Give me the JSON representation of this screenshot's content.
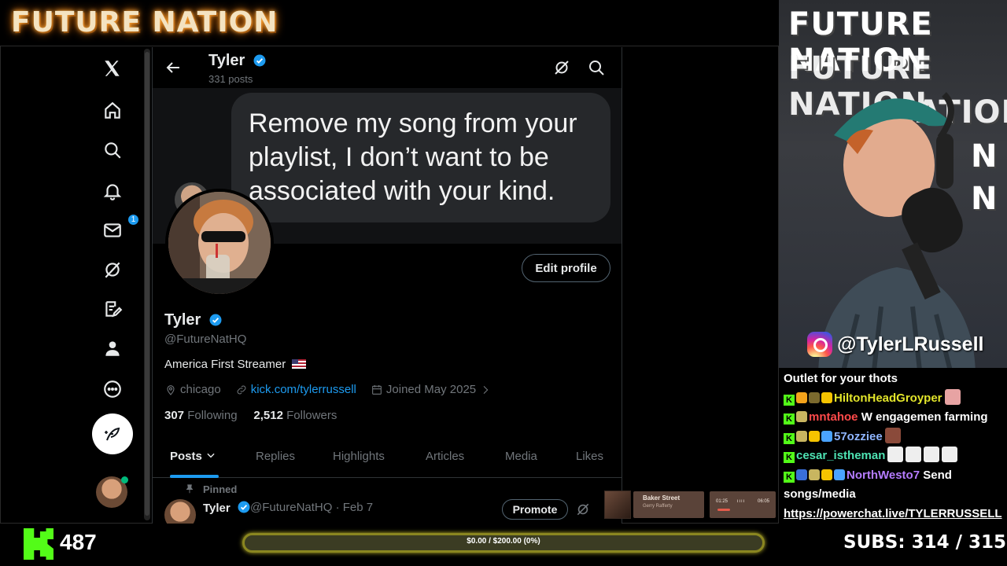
{
  "stream": {
    "title": "FUTURE NATION",
    "cam_lines": [
      "FUTURE NATION",
      "FUTURE NATION",
      "NATION",
      "N",
      "N"
    ],
    "instagram_handle": "@TylerLRussell",
    "kick_viewers": "487",
    "goal_text": "$0.00 / $200.00 (0%)",
    "subs_label": "SUBS:",
    "subs_value": "314 / 315"
  },
  "x_nav": {
    "icons": [
      "x-logo-icon",
      "home-icon",
      "search-icon",
      "bell-icon",
      "mail-icon",
      "grok-icon",
      "edit-note-icon",
      "profile-icon",
      "more-icon"
    ],
    "mail_badge": "1"
  },
  "profile": {
    "header_name": "Tyler",
    "header_posts": "331 posts",
    "banner_text": "Remove my song from your playlist, I don’t want to be associated with your kind.",
    "edit_button": "Edit profile",
    "name": "Tyler",
    "handle": "@FutureNatHQ",
    "bio": "America First Streamer",
    "location": "chicago",
    "link": "kick.com/tylerrussell",
    "joined": "Joined May 2025",
    "following_count": "307",
    "following_label": "Following",
    "followers_count": "2,512",
    "followers_label": "Followers",
    "tabs": [
      "Posts",
      "Replies",
      "Highlights",
      "Articles",
      "Media",
      "Likes"
    ],
    "pinned_label": "Pinned",
    "post": {
      "name": "Tyler",
      "handle_date": "@FutureNatHQ · Feb 7",
      "promote_button": "Promote"
    }
  },
  "music": {
    "title": "Baker Street",
    "artist": "Gerry Rafferty",
    "time_elapsed": "01:25",
    "time_total": "06:05"
  },
  "chat": {
    "header": "Outlet for your thots",
    "messages": [
      {
        "user": "HiltonHeadGroyper",
        "color": "#e2e52b",
        "text": ""
      },
      {
        "user": "mntahoe",
        "color": "#ff4a4a",
        "text": "W engagemen farming"
      },
      {
        "user": "57ozziee",
        "color": "#8fb5ff",
        "text": ""
      },
      {
        "user": "cesar_istheman",
        "color": "#4ee3b3",
        "text": ""
      },
      {
        "user": "NorthWesto7",
        "color": "#b57cff",
        "text": "Send songs/media"
      }
    ],
    "link": "https://powerchat.live/TYLERRUSSELL"
  },
  "colors": {
    "accent": "#1d9bf0",
    "kick_green": "#53fc18",
    "background": "#000000"
  }
}
